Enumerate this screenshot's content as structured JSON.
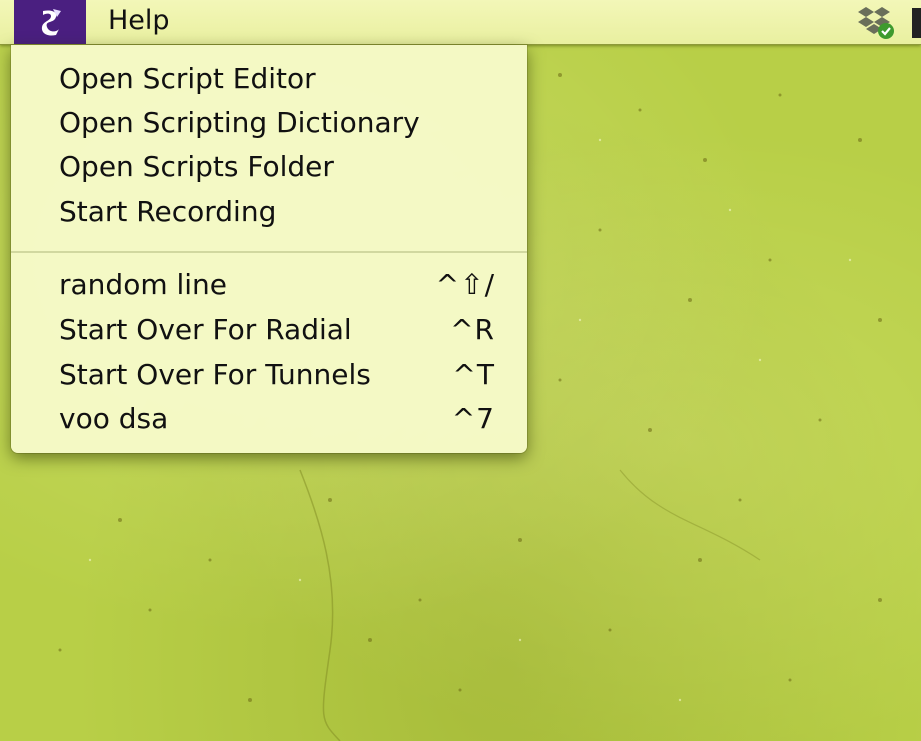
{
  "menubar": {
    "script_menu_icon": "script-scroll-icon",
    "help_label": "Help",
    "status_icon": "dropbox-sync-icon",
    "accent_color": "#4a1f80"
  },
  "script_menu": {
    "items": [
      {
        "label": "Open Script Editor",
        "shortcut": ""
      },
      {
        "label": "Open Scripting Dictionary",
        "shortcut": ""
      },
      {
        "label": "Open Scripts Folder",
        "shortcut": ""
      },
      {
        "label": "Start Recording",
        "shortcut": ""
      }
    ],
    "script_items": [
      {
        "label": "random line",
        "shortcut": "^⇧/"
      },
      {
        "label": "Start Over For Radial",
        "shortcut": "^R"
      },
      {
        "label": "Start Over For Tunnels",
        "shortcut": "^T"
      },
      {
        "label": "voo dsa",
        "shortcut": "^7"
      }
    ]
  }
}
